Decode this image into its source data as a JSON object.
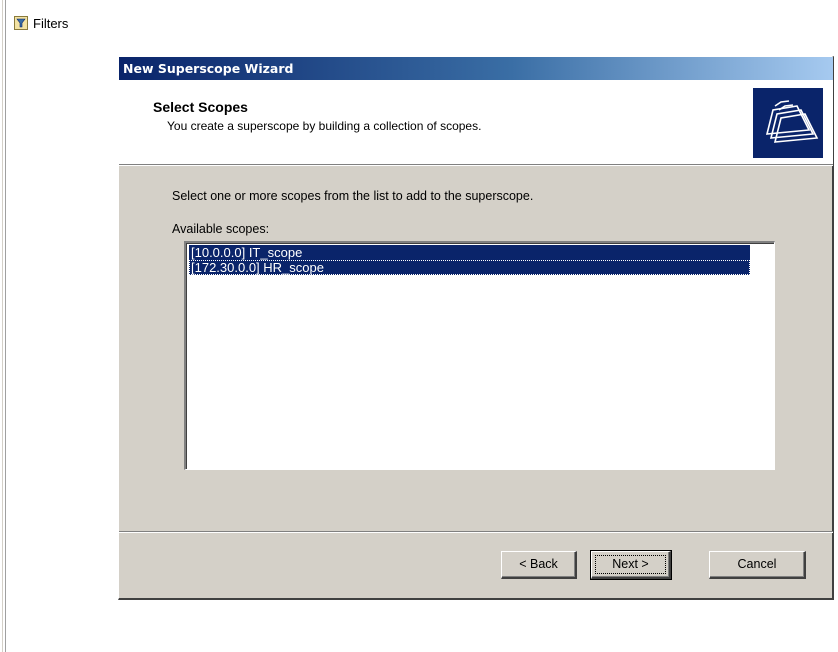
{
  "mmc": {
    "filters_label": "Filters"
  },
  "wizard": {
    "title": "New Superscope Wizard",
    "header": {
      "title": "Select Scopes",
      "subtitle": "You create a superscope by building a collection of scopes."
    },
    "instruction": "Select one or more scopes from the list to add to the superscope.",
    "available_label": "Available scopes:",
    "scopes": [
      {
        "label": "[10.0.0.0] IT_scope",
        "selected": true
      },
      {
        "label": "[172.30.0.0] HR_scope",
        "selected": true
      }
    ],
    "buttons": {
      "back": "< Back",
      "next": "Next >",
      "cancel": "Cancel"
    }
  },
  "colors": {
    "title_bar_start": "#0a246a",
    "title_bar_end": "#a6caf0",
    "dialog_face": "#d4d0c8",
    "selection": "#0a246a"
  },
  "icons": {
    "filters": "filter-funnel-icon",
    "header": "folders-stack-icon"
  }
}
